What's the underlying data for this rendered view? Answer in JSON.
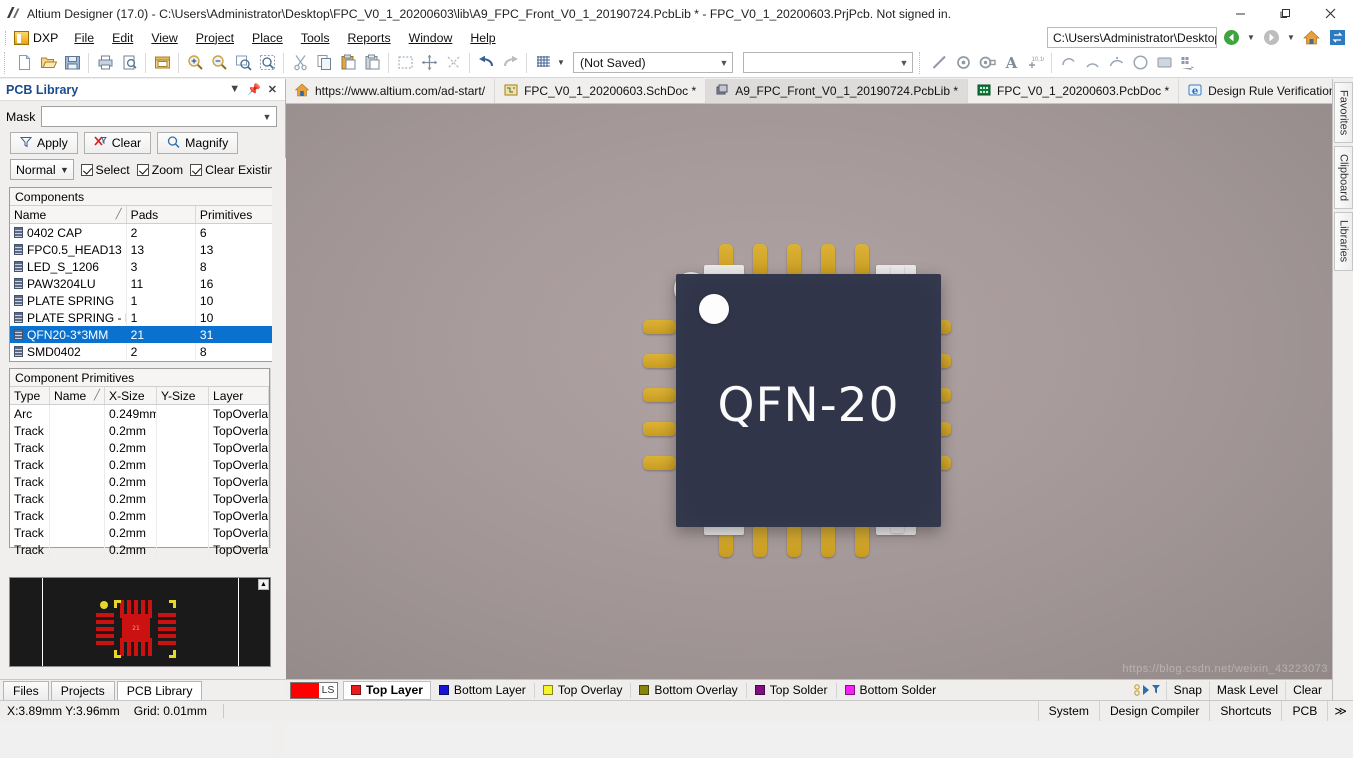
{
  "window": {
    "title": "Altium Designer (17.0) - C:\\Users\\Administrator\\Desktop\\FPC_V0_1_20200603\\lib\\A9_FPC_Front_V0_1_20190724.PcbLib * - FPC_V0_1_20200603.PrjPcb. Not signed in.",
    "app_icon": "altium-logo-icon",
    "minimize": "–",
    "maximize": "❐",
    "close": "✕"
  },
  "menubar": {
    "dxp_label": "DXP",
    "items": [
      "File",
      "Edit",
      "View",
      "Project",
      "Place",
      "Tools",
      "Reports",
      "Window",
      "Help"
    ]
  },
  "toolbar": {
    "buttons": [
      {
        "name": "new-document-icon",
        "glyph": "὜B"
      },
      {
        "name": "open-document-icon",
        "glyph": "open"
      },
      {
        "name": "save-document-icon",
        "glyph": "save"
      },
      {
        "name": "print-icon",
        "glyph": "print"
      },
      {
        "name": "print-preview-icon",
        "glyph": "preview"
      },
      {
        "name": "open-project-icon",
        "glyph": "project"
      },
      {
        "name": "zoom-in-icon",
        "glyph": "zoomin"
      },
      {
        "name": "zoom-out-icon",
        "glyph": "zoomout"
      },
      {
        "name": "zoom-fit-icon",
        "glyph": "zoomfit"
      },
      {
        "name": "zoom-area-icon",
        "glyph": "zoomarea"
      },
      {
        "name": "cut-icon",
        "glyph": "cut"
      },
      {
        "name": "copy-icon",
        "glyph": "copy"
      },
      {
        "name": "paste-icon",
        "glyph": "paste"
      },
      {
        "name": "paste-special-icon",
        "glyph": "paste2"
      },
      {
        "name": "select-area-icon",
        "glyph": "selectarea"
      },
      {
        "name": "move-icon",
        "glyph": "move"
      },
      {
        "name": "deselect-icon",
        "glyph": "deselect"
      },
      {
        "name": "undo-icon",
        "glyph": "undo"
      },
      {
        "name": "redo-icon",
        "glyph": "redo"
      },
      {
        "name": "grid-icon",
        "glyph": "grid"
      }
    ],
    "variant_combo": "(Not Saved)",
    "second_combo": "",
    "place_buttons": [
      {
        "name": "place-line-icon"
      },
      {
        "name": "place-pad-icon"
      },
      {
        "name": "place-via-icon"
      },
      {
        "name": "place-string-icon"
      },
      {
        "name": "place-coordinate-icon"
      },
      {
        "name": "place-arc-center-icon"
      },
      {
        "name": "place-arc-edge-icon"
      },
      {
        "name": "place-arc-any-icon"
      },
      {
        "name": "place-full-circle-icon"
      },
      {
        "name": "place-fill-icon"
      },
      {
        "name": "place-component-icon"
      }
    ],
    "navigation_path": "C:\\Users\\Administrator\\Desktop"
  },
  "doctabs": [
    {
      "label": "https://www.altium.com/ad-start/",
      "icon": "home-icon",
      "active": false
    },
    {
      "label": "FPC_V0_1_20200603.SchDoc *",
      "icon": "schdoc-icon",
      "active": false
    },
    {
      "label": "A9_FPC_Front_V0_1_20190724.PcbLib *",
      "icon": "pcblib-icon",
      "active": true
    },
    {
      "label": "FPC_V0_1_20200603.PcbDoc *",
      "icon": "pcbdoc-icon",
      "active": false
    },
    {
      "label": "Design Rule Verification Report",
      "icon": "report-icon",
      "active": false
    }
  ],
  "panel": {
    "title": "PCB Library",
    "mask_label": "Mask",
    "mask_value": "",
    "buttons": [
      {
        "label": "Apply",
        "icon": "filter-icon"
      },
      {
        "label": "Clear",
        "icon": "clear-filter-icon"
      },
      {
        "label": "Magnify",
        "icon": "magnify-icon"
      }
    ],
    "mode_select": "Normal",
    "checkboxes": [
      {
        "label": "Select",
        "checked": true
      },
      {
        "label": "Zoom",
        "checked": true
      },
      {
        "label": "Clear Existing",
        "checked": true
      }
    ],
    "components": {
      "caption": "Components",
      "headers": [
        "Name",
        "Pads",
        "Primitives"
      ],
      "sort_indicator": "╱",
      "rows": [
        {
          "name": "0402 CAP",
          "pads": "2",
          "primitives": "6",
          "selected": false
        },
        {
          "name": "FPC0.5_HEAD13",
          "pads": "13",
          "primitives": "13",
          "selected": false
        },
        {
          "name": "LED_S_1206",
          "pads": "3",
          "primitives": "8",
          "selected": false
        },
        {
          "name": "PAW3204LU",
          "pads": "11",
          "primitives": "16",
          "selected": false
        },
        {
          "name": "PLATE SPRING",
          "pads": "1",
          "primitives": "10",
          "selected": false
        },
        {
          "name": "PLATE SPRING - DU",
          "pads": "1",
          "primitives": "10",
          "selected": false
        },
        {
          "name": "QFN20-3*3MM",
          "pads": "21",
          "primitives": "31",
          "selected": true
        },
        {
          "name": "SMD0402",
          "pads": "2",
          "primitives": "8",
          "selected": false
        }
      ]
    },
    "primitives": {
      "caption": "Component Primitives",
      "headers": [
        "Type",
        "Name",
        "X-Size",
        "Y-Size",
        "Layer"
      ],
      "sort_indicator": "╱",
      "rows": [
        {
          "type": "Arc",
          "name": "",
          "xsize": "0.249mm",
          "ysize": "",
          "layer": "TopOverla"
        },
        {
          "type": "Track",
          "name": "",
          "xsize": "0.2mm",
          "ysize": "",
          "layer": "TopOverla"
        },
        {
          "type": "Track",
          "name": "",
          "xsize": "0.2mm",
          "ysize": "",
          "layer": "TopOverla"
        },
        {
          "type": "Track",
          "name": "",
          "xsize": "0.2mm",
          "ysize": "",
          "layer": "TopOverla"
        },
        {
          "type": "Track",
          "name": "",
          "xsize": "0.2mm",
          "ysize": "",
          "layer": "TopOverla"
        },
        {
          "type": "Track",
          "name": "",
          "xsize": "0.2mm",
          "ysize": "",
          "layer": "TopOverla"
        },
        {
          "type": "Track",
          "name": "",
          "xsize": "0.2mm",
          "ysize": "",
          "layer": "TopOverla"
        },
        {
          "type": "Track",
          "name": "",
          "xsize": "0.2mm",
          "ysize": "",
          "layer": "TopOverla"
        },
        {
          "type": "Track",
          "name": "",
          "xsize": "0.2mm",
          "ysize": "",
          "layer": "TopOverla"
        }
      ]
    },
    "preview_label": "component-preview",
    "bottom_tabs": [
      {
        "label": "Files",
        "active": false
      },
      {
        "label": "Projects",
        "active": false
      },
      {
        "label": "PCB Library",
        "active": true
      }
    ]
  },
  "canvas": {
    "component_name": "QFN-20",
    "body_color": "#313549",
    "pin_color": "#dcb236",
    "background_color": "#a89b9b",
    "watermark": "https://blog.csdn.net/weixin_43223073"
  },
  "layerbar": {
    "color_swatch": "#ff0000",
    "ls_label": "LS",
    "layers": [
      {
        "label": "Top Layer",
        "color": "#e81c1c",
        "active": true
      },
      {
        "label": "Bottom Layer",
        "color": "#1414d2",
        "active": false
      },
      {
        "label": "Top Overlay",
        "color": "#f5f52d",
        "active": false
      },
      {
        "label": "Bottom Overlay",
        "color": "#86860e",
        "active": false
      },
      {
        "label": "Top Solder",
        "color": "#820f82",
        "active": false
      },
      {
        "label": "Bottom Solder",
        "color": "#f520f5",
        "active": false
      }
    ],
    "right_tools": [
      {
        "label": "Snap"
      },
      {
        "label": "Mask Level"
      },
      {
        "label": "Clear"
      }
    ],
    "filter_icon": "layer-filter-icon"
  },
  "statusbar": {
    "coords": "X:3.89mm Y:3.96mm",
    "grid": "Grid: 0.01mm",
    "right_buttons": [
      "System",
      "Design Compiler",
      "Shortcuts",
      "PCB"
    ],
    "overflow": "≫"
  },
  "rightdock": {
    "tabs": [
      "Favorites",
      "Clipboard",
      "Libraries"
    ]
  }
}
